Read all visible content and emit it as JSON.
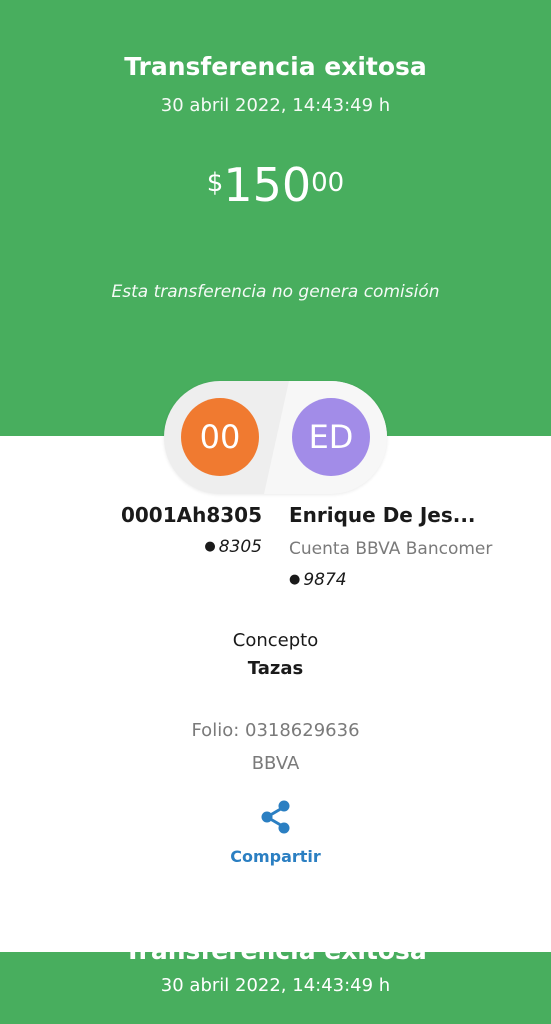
{
  "header": {
    "title": "Transferencia exitosa",
    "datetime": "30 abril 2022, 14:43:49 h"
  },
  "amount": {
    "currency": "$",
    "integer": "150",
    "decimals": "00"
  },
  "note": "Esta transferencia no genera comisión",
  "origin": {
    "initials": "00",
    "name": "0001Ah8305",
    "account": "8305"
  },
  "destination": {
    "initials": "ED",
    "name": "Enrique De Jes...",
    "bank": "Cuenta BBVA Bancomer",
    "account": "9874"
  },
  "concept": {
    "label": "Concepto",
    "value": "Tazas"
  },
  "folio": "Folio: 0318629636",
  "bank": "BBVA",
  "share": {
    "label": "Compartir",
    "icon": "share-icon"
  },
  "footer": {
    "title": "Transferencia exitosa",
    "datetime": "30 abril 2022, 14:43:49 h"
  },
  "colors": {
    "primary_green": "#48ae5e",
    "origin_avatar": "#f07a30",
    "destination_avatar": "#a28ce8",
    "link_blue": "#2b7fc2"
  }
}
